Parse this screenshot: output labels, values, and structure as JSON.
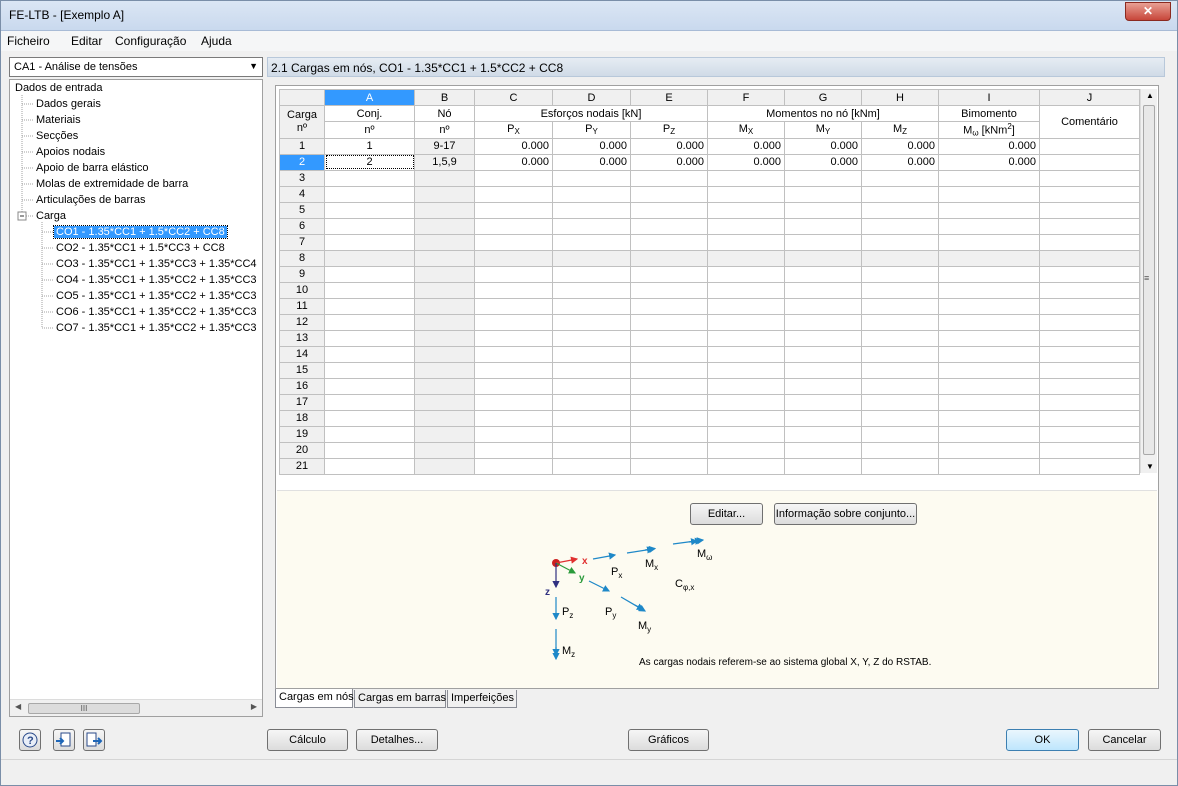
{
  "window": {
    "title": "FE-LTB - [Exemplo A]",
    "close_glyph": "✕"
  },
  "menu": [
    "Ficheiro",
    "Editar",
    "Configuração",
    "Ajuda"
  ],
  "case_selector": {
    "value": "CA1 - Análise de tensões"
  },
  "tree": {
    "root": "Dados de entrada",
    "items": [
      "Dados gerais",
      "Materiais",
      "Secções",
      "Apoios nodais",
      "Apoio de barra elástico",
      "Molas de extremidade de barra",
      "Articulações de barras"
    ],
    "load_group": "Carga",
    "load_items": [
      "CO1 - 1.35*CC1 + 1.5*CC2 + CC8",
      "CO2 - 1.35*CC1 + 1.5*CC3 + CC8",
      "CO3 - 1.35*CC1 + 1.35*CC3 + 1.35*CC4",
      "CO4 - 1.35*CC1 + 1.35*CC2 + 1.35*CC3",
      "CO5 - 1.35*CC1 + 1.35*CC2 + 1.35*CC3",
      "CO6 - 1.35*CC1 + 1.35*CC2 + 1.35*CC3",
      "CO7 - 1.35*CC1 + 1.35*CC2 + 1.35*CC3"
    ],
    "selected_index": 0
  },
  "section_title": "2.1 Cargas em nós, CO1 - 1.35*CC1 + 1.5*CC2 + CC8",
  "table": {
    "column_letters": [
      "A",
      "B",
      "C",
      "D",
      "E",
      "F",
      "G",
      "H",
      "I",
      "J"
    ],
    "row_header": [
      "Carga",
      "nº"
    ],
    "headers": {
      "conj": [
        "Conj.",
        "nº"
      ],
      "no": [
        "Nó",
        "nº"
      ],
      "esforcos": "Esforços nodais  [kN]",
      "px": [
        "P",
        "X"
      ],
      "py": [
        "P",
        "Y"
      ],
      "pz": [
        "P",
        "Z"
      ],
      "momentos": "Momentos no nó  [kNm]",
      "mx": [
        "M",
        "X"
      ],
      "my": [
        "M",
        "Y"
      ],
      "mz": [
        "M",
        "Z"
      ],
      "bimomento": "Bimomento",
      "momega": "M",
      "omega": "ω",
      "momega_unit": " [kNm",
      "momega_exp": "2",
      "momega_close": "]",
      "comentario": "Comentário"
    },
    "rows": [
      {
        "n": "1",
        "conj": "1",
        "no": "9-17",
        "px": "0.000",
        "py": "0.000",
        "pz": "0.000",
        "mx": "0.000",
        "my": "0.000",
        "mz": "0.000",
        "mw": "0.000",
        "com": ""
      },
      {
        "n": "2",
        "conj": "2",
        "no": "1,5,9",
        "px": "0.000",
        "py": "0.000",
        "pz": "0.000",
        "mx": "0.000",
        "my": "0.000",
        "mz": "0.000",
        "mw": "0.000",
        "com": ""
      },
      {
        "n": "3"
      },
      {
        "n": "4"
      },
      {
        "n": "5"
      },
      {
        "n": "6"
      },
      {
        "n": "7"
      },
      {
        "n": "8"
      },
      {
        "n": "9"
      },
      {
        "n": "10"
      },
      {
        "n": "11"
      },
      {
        "n": "12"
      },
      {
        "n": "13"
      },
      {
        "n": "14"
      },
      {
        "n": "15"
      },
      {
        "n": "16"
      },
      {
        "n": "17"
      },
      {
        "n": "18"
      },
      {
        "n": "19"
      },
      {
        "n": "20"
      },
      {
        "n": "21"
      }
    ],
    "selected_row": 1,
    "gray_row": 7
  },
  "info": {
    "edit_button": "Editar...",
    "info_button": "Informação sobre conjunto...",
    "note": "As cargas nodais referem-se ao sistema global X, Y, Z do RSTAB.",
    "axes": {
      "x": "x",
      "y": "y",
      "z": "z"
    },
    "labels": {
      "px": "P",
      "px_sub": "x",
      "mx": "M",
      "mx_sub": "x",
      "mw": "M",
      "mw_sub": "ω",
      "cphi": "C",
      "cphi_sub": "φ,x",
      "py": "P",
      "py_sub": "y",
      "my": "M",
      "my_sub": "y",
      "pz": "P",
      "pz_sub": "z",
      "mz": "M",
      "mz_sub": "z"
    }
  },
  "tabs": [
    "Cargas em nós",
    "Cargas em barras",
    "Imperfeições"
  ],
  "active_tab": 0,
  "buttons": {
    "calculo": "Cálculo",
    "detalhes": "Detalhes...",
    "graficos": "Gráficos",
    "ok": "OK",
    "cancelar": "Cancelar"
  },
  "icons": [
    "help-icon",
    "import-icon",
    "export-icon"
  ]
}
